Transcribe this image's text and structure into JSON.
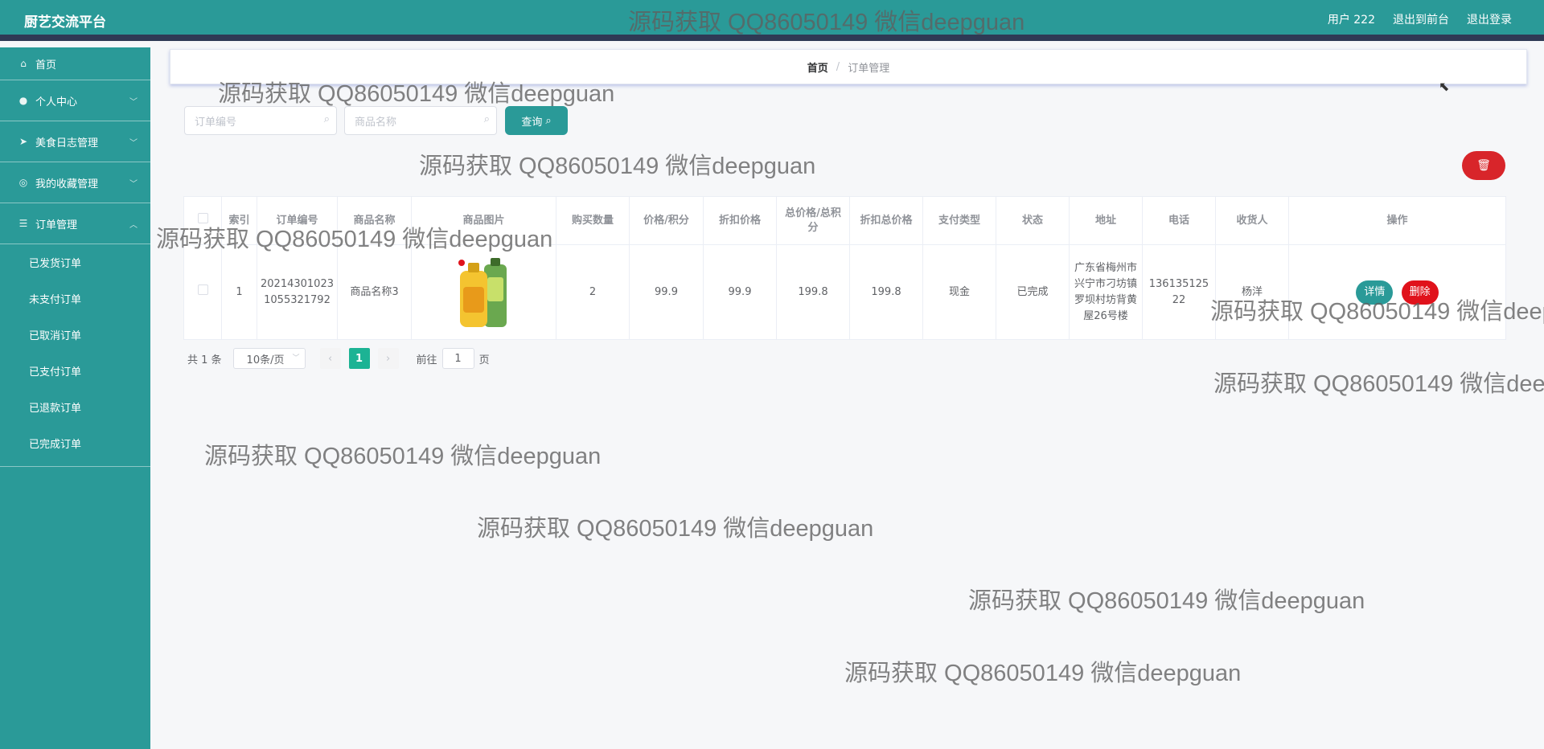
{
  "app": {
    "title": "厨艺交流平台",
    "user_label": "用户 222",
    "front_link": "退出到前台",
    "logout_link": "退出登录"
  },
  "sidebar": {
    "home": "首页",
    "personal": "个人中心",
    "food_log": "美食日志管理",
    "favorites": "我的收藏管理",
    "orders": "订单管理",
    "sub": [
      "已发货订单",
      "未支付订单",
      "已取消订单",
      "已支付订单",
      "已退款订单",
      "已完成订单"
    ]
  },
  "breadcrumb": {
    "home": "首页",
    "sep": "/",
    "current": "订单管理"
  },
  "search": {
    "order_no_placeholder": "订单编号",
    "product_name_placeholder": "商品名称",
    "query_label": "查询"
  },
  "table": {
    "headers": [
      "索引",
      "订单编号",
      "商品名称",
      "商品图片",
      "购买数量",
      "价格/积分",
      "折扣价格",
      "总价格/总积分",
      "折扣总价格",
      "支付类型",
      "状态",
      "地址",
      "电话",
      "收货人",
      "操作"
    ],
    "rows": [
      {
        "index": "1",
        "order_no": "202143010231055321792",
        "product_name": "商品名称3",
        "quantity": "2",
        "price": "99.9",
        "discount_price": "99.9",
        "total": "199.8",
        "discount_total": "199.8",
        "pay_type": "现金",
        "status": "已完成",
        "address": "广东省梅州市兴宁市刁坊镇罗坝村坊背黄屋26号楼",
        "phone": "13613512522",
        "receiver": "杨洋",
        "detail_label": "详情",
        "delete_label": "删除"
      }
    ]
  },
  "pagination": {
    "total_text": "共 1 条",
    "page_size": "10条/页",
    "current_page": "1",
    "goto_prefix": "前往",
    "goto_value": "1",
    "goto_suffix": "页"
  },
  "watermark_text": "源码获取 QQ86050149 微信deepguan",
  "colors": {
    "primary": "#2a9a98",
    "header_strip": "#2f3a55",
    "danger": "#d8252a",
    "page_active": "#1cb394"
  }
}
